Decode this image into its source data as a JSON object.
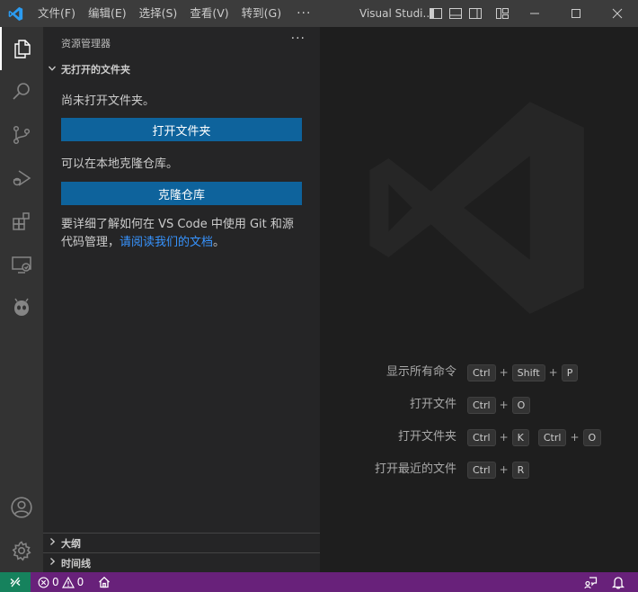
{
  "colors": {
    "titlebar_bg": "#3c3c3c",
    "activitybar_bg": "#333333",
    "sidebar_bg": "#252526",
    "editor_bg": "#1e1e1e",
    "button_bg": "#0e639c",
    "link": "#3794ff",
    "statusbar_bg": "#68217a",
    "remote_bg": "#16825d"
  },
  "titlebar": {
    "menus": [
      "文件(F)",
      "编辑(E)",
      "选择(S)",
      "查看(V)",
      "转到(G)"
    ],
    "more": "···",
    "title": "Visual Studi..."
  },
  "activitybar": {
    "icons": [
      "explorer-icon",
      "search-icon",
      "source-control-icon",
      "run-debug-icon",
      "extensions-icon",
      "remote-explorer-icon",
      "platformio-icon",
      "account-icon",
      "manage-gear-icon"
    ]
  },
  "sidebar": {
    "title": "资源管理器",
    "more": "···",
    "section": "无打开的文件夹",
    "no_folder_text": "尚未打开文件夹。",
    "open_folder_button": "打开文件夹",
    "clone_text": "可以在本地克隆仓库。",
    "clone_button": "克隆仓库",
    "help_text": "要详细了解如何在 VS Code 中使用 Git 和源代码管理，",
    "help_link": "请阅读我们的文档",
    "help_end": "。",
    "outline": "大纲",
    "timeline": "时间线"
  },
  "editor": {
    "shortcuts": [
      {
        "label": "显示所有命令",
        "keys": [
          [
            "Ctrl",
            "Shift",
            "P"
          ]
        ]
      },
      {
        "label": "打开文件",
        "keys": [
          [
            "Ctrl",
            "O"
          ]
        ]
      },
      {
        "label": "打开文件夹",
        "keys": [
          [
            "Ctrl",
            "K"
          ],
          [
            "Ctrl",
            "O"
          ]
        ]
      },
      {
        "label": "打开最近的文件",
        "keys": [
          [
            "Ctrl",
            "R"
          ]
        ]
      }
    ]
  },
  "statusbar": {
    "errors": "0",
    "warnings": "0"
  }
}
